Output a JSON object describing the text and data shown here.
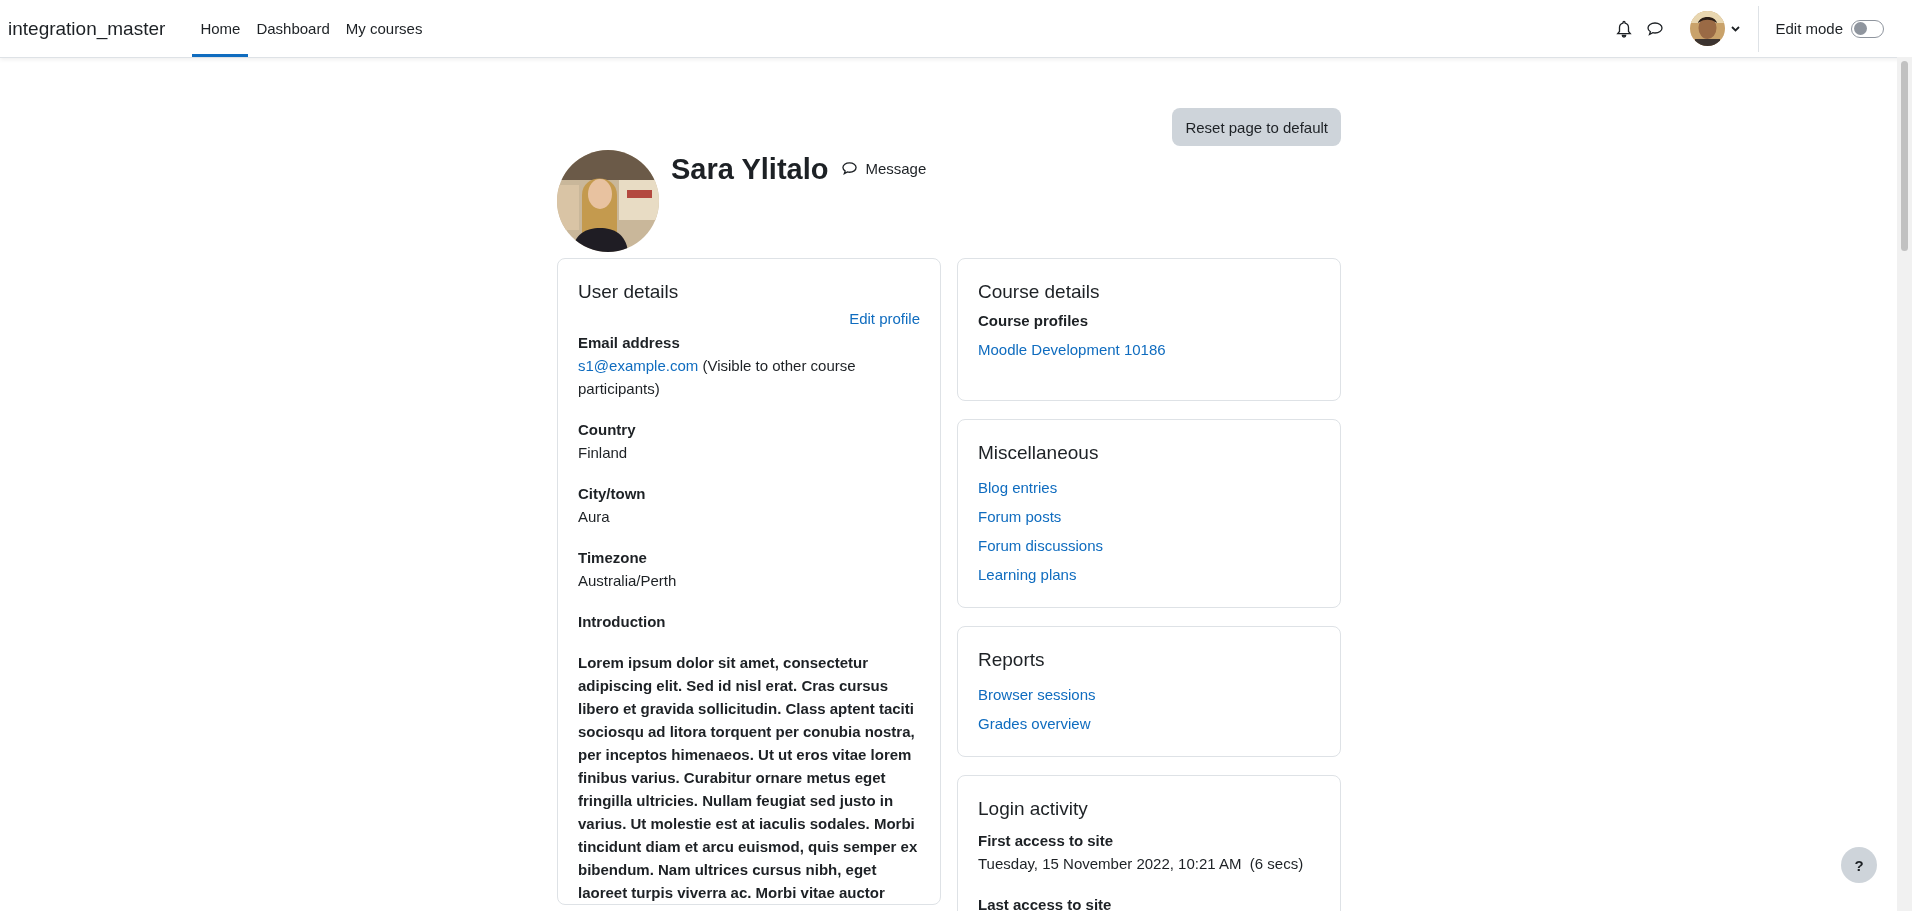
{
  "navbar": {
    "site_name": "integration_master",
    "nav": [
      {
        "label": "Home",
        "selected": true
      },
      {
        "label": "Dashboard",
        "selected": false
      },
      {
        "label": "My courses",
        "selected": false
      }
    ],
    "edit_mode": {
      "label": "Edit mode",
      "on": false
    }
  },
  "reset_button": "Reset page to default",
  "profile": {
    "name": "Sara Ylitalo",
    "message": "Message"
  },
  "user_details": {
    "title": "User details",
    "edit_link": "Edit profile",
    "fields": [
      {
        "label": "Email address",
        "link": "s1@example.com",
        "value": "(Visible to other course participants)"
      },
      {
        "label": "Country",
        "value": "Finland"
      },
      {
        "label": "City/town",
        "value": "Aura"
      },
      {
        "label": "Timezone",
        "value": "Australia/Perth"
      },
      {
        "label": "Introduction"
      }
    ],
    "introduction": "Lorem ipsum dolor sit amet, consectetur adipiscing elit. Sed id nisl erat. Cras cursus libero et gravida sollicitudin. Class aptent taciti sociosqu ad litora torquent per conubia nostra, per inceptos himenaeos. Ut ut eros vitae lorem finibus varius. Curabitur ornare metus eget fringilla ultricies. Nullam feugiat sed justo in varius. Ut molestie est at iaculis sodales. Morbi tincidunt diam et arcu euismod, quis semper ex bibendum. Nam ultrices cursus nibh, eget laoreet turpis viverra ac. Morbi vitae auctor"
  },
  "course_details": {
    "title": "Course details",
    "subtitle": "Course profiles",
    "links": [
      "Moodle Development 10186"
    ]
  },
  "miscellaneous": {
    "title": "Miscellaneous",
    "links": [
      "Blog entries",
      "Forum posts",
      "Forum discussions",
      "Learning plans"
    ]
  },
  "reports": {
    "title": "Reports",
    "links": [
      "Browser sessions",
      "Grades overview"
    ]
  },
  "login_activity": {
    "title": "Login activity",
    "items": [
      {
        "label": "First access to site",
        "value": "Tuesday, 15 November 2022, 10:21 AM  (6 secs)"
      },
      {
        "label": "Last access to site"
      }
    ]
  },
  "help_button": "?"
}
